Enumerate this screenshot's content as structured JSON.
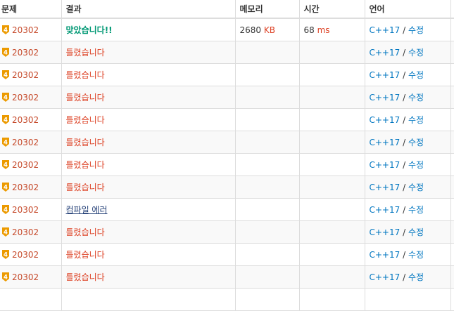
{
  "table": {
    "headers": [
      "문제",
      "결과",
      "메모리",
      "시간",
      "언어",
      ""
    ],
    "rows": [
      {
        "problem": "20302",
        "tier": "4",
        "result": "맞았습니다!!",
        "status": "ac",
        "memory": "2680",
        "memory_unit": "KB",
        "time": "68",
        "time_unit": "ms",
        "language": "C++17",
        "sep": " / ",
        "edit": "수정"
      },
      {
        "problem": "20302",
        "tier": "4",
        "result": "틀렸습니다",
        "status": "wa",
        "memory": "",
        "memory_unit": "",
        "time": "",
        "time_unit": "",
        "language": "C++17",
        "sep": " / ",
        "edit": "수정"
      },
      {
        "problem": "20302",
        "tier": "4",
        "result": "틀렸습니다",
        "status": "wa",
        "memory": "",
        "memory_unit": "",
        "time": "",
        "time_unit": "",
        "language": "C++17",
        "sep": " / ",
        "edit": "수정"
      },
      {
        "problem": "20302",
        "tier": "4",
        "result": "틀렸습니다",
        "status": "wa",
        "memory": "",
        "memory_unit": "",
        "time": "",
        "time_unit": "",
        "language": "C++17",
        "sep": " / ",
        "edit": "수정"
      },
      {
        "problem": "20302",
        "tier": "4",
        "result": "틀렸습니다",
        "status": "wa",
        "memory": "",
        "memory_unit": "",
        "time": "",
        "time_unit": "",
        "language": "C++17",
        "sep": " / ",
        "edit": "수정"
      },
      {
        "problem": "20302",
        "tier": "4",
        "result": "틀렸습니다",
        "status": "wa",
        "memory": "",
        "memory_unit": "",
        "time": "",
        "time_unit": "",
        "language": "C++17",
        "sep": " / ",
        "edit": "수정"
      },
      {
        "problem": "20302",
        "tier": "4",
        "result": "틀렸습니다",
        "status": "wa",
        "memory": "",
        "memory_unit": "",
        "time": "",
        "time_unit": "",
        "language": "C++17",
        "sep": " / ",
        "edit": "수정"
      },
      {
        "problem": "20302",
        "tier": "4",
        "result": "틀렸습니다",
        "status": "wa",
        "memory": "",
        "memory_unit": "",
        "time": "",
        "time_unit": "",
        "language": "C++17",
        "sep": " / ",
        "edit": "수정"
      },
      {
        "problem": "20302",
        "tier": "4",
        "result": "컴파일 에러",
        "status": "ce",
        "memory": "",
        "memory_unit": "",
        "time": "",
        "time_unit": "",
        "language": "C++17",
        "sep": " / ",
        "edit": "수정"
      },
      {
        "problem": "20302",
        "tier": "4",
        "result": "틀렸습니다",
        "status": "wa",
        "memory": "",
        "memory_unit": "",
        "time": "",
        "time_unit": "",
        "language": "C++17",
        "sep": " / ",
        "edit": "수정"
      },
      {
        "problem": "20302",
        "tier": "4",
        "result": "틀렸습니다",
        "status": "wa",
        "memory": "",
        "memory_unit": "",
        "time": "",
        "time_unit": "",
        "language": "C++17",
        "sep": " / ",
        "edit": "수정"
      },
      {
        "problem": "20302",
        "tier": "4",
        "result": "틀렸습니다",
        "status": "wa",
        "memory": "",
        "memory_unit": "",
        "time": "",
        "time_unit": "",
        "language": "C++17",
        "sep": " / ",
        "edit": "수정"
      },
      {
        "problem": "",
        "tier": "",
        "result": "",
        "status": "",
        "memory": "",
        "memory_unit": "",
        "time": "",
        "time_unit": "",
        "language": "",
        "sep": "",
        "edit": ""
      }
    ]
  },
  "colors": {
    "tier_gold": "#ec9a00",
    "accepted": "#009874",
    "wrong": "#dd4124",
    "link": "#0076c0"
  },
  "icons": {
    "tier": "gold-tier-badge-icon"
  }
}
